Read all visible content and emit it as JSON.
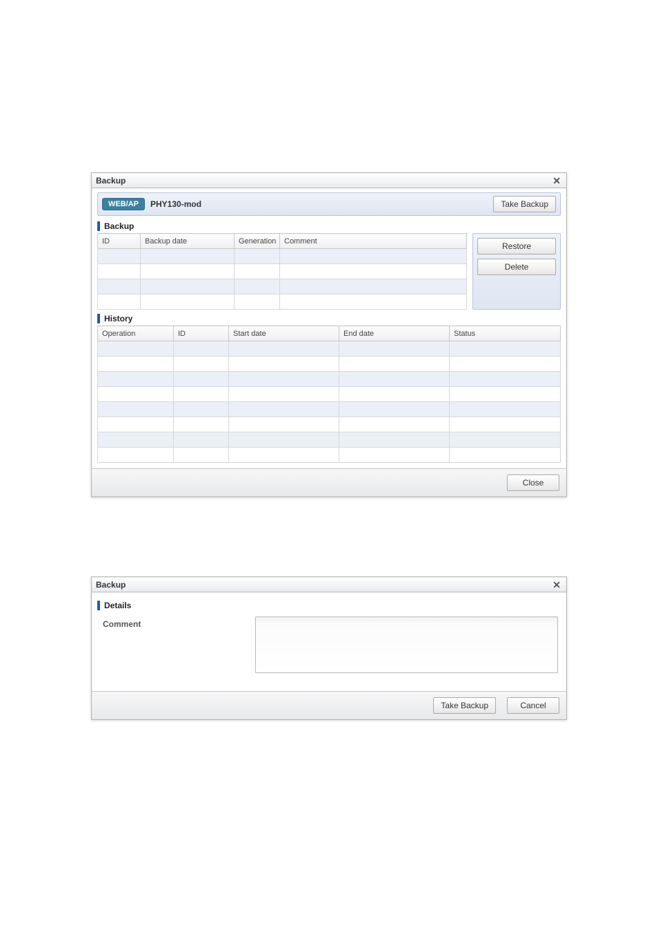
{
  "dialog1": {
    "title": "Backup",
    "topbar": {
      "badge": "WEB/AP",
      "device": "PHY130-mod"
    },
    "take_backup_btn": "Take Backup",
    "section_backup": "Backup",
    "backup_cols": {
      "id": "ID",
      "backup_date": "Backup date",
      "generation": "Generation",
      "comment": "Comment"
    },
    "restore_btn": "Restore",
    "delete_btn": "Delete",
    "section_history": "History",
    "history_cols": {
      "operation": "Operation",
      "id": "ID",
      "start": "Start date",
      "end": "End date",
      "status": "Status"
    },
    "close_btn": "Close"
  },
  "dialog2": {
    "title": "Backup",
    "section_details": "Details",
    "comment_label": "Comment",
    "comment_value": "",
    "take_backup_btn": "Take Backup",
    "cancel_btn": "Cancel"
  }
}
